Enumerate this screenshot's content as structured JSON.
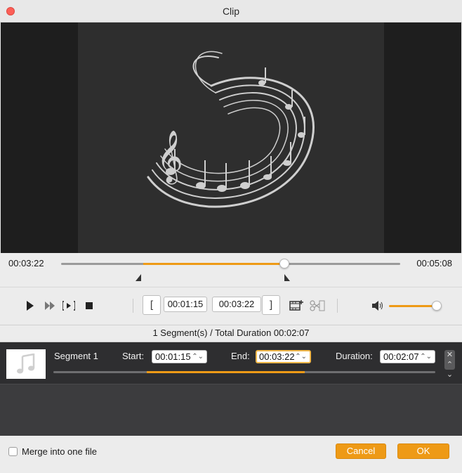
{
  "window": {
    "title": "Clip",
    "close_icon": "close-icon"
  },
  "preview": {
    "image": "music-notes-swirl"
  },
  "timeline": {
    "current_time": "00:03:22",
    "total_time": "00:05:08",
    "selection_start_fraction": 0.244,
    "selection_end_fraction": 0.654,
    "playhead_fraction": 0.654
  },
  "controls": {
    "start_time": "00:01:15",
    "end_time": "00:03:22",
    "set_start_label": "[",
    "set_end_label": "]",
    "volume_fraction": 0.9,
    "icons": [
      "play-icon",
      "fast-forward-icon",
      "play-selection-icon",
      "stop-icon",
      "add-segment-icon",
      "cut-icon",
      "volume-icon"
    ]
  },
  "summary": {
    "text": "1 Segment(s) / Total Duration 00:02:07"
  },
  "segments": [
    {
      "name": "Segment 1",
      "start_label": "Start:",
      "start": "00:01:15",
      "end_label": "End:",
      "end": "00:03:22",
      "duration_label": "Duration:",
      "duration": "00:02:07"
    }
  ],
  "footer": {
    "merge_label": "Merge into one file",
    "merge_checked": false,
    "cancel_label": "Cancel",
    "ok_label": "OK"
  },
  "colors": {
    "accent": "#ee9a16",
    "close": "#fc5f57"
  }
}
